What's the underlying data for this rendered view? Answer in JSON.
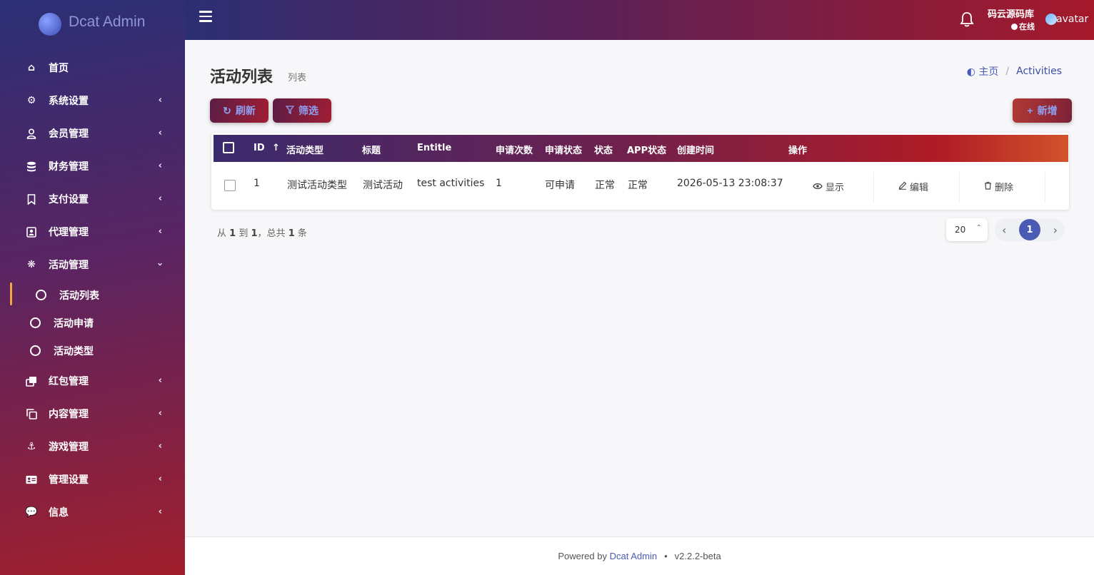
{
  "brand": {
    "name": "Dcat Admin"
  },
  "topbar": {
    "user_name": "码云源码库",
    "user_status": "在线",
    "avatar_alt": "avatar"
  },
  "sidebar": {
    "items": [
      {
        "label": "首页",
        "icon": "home-icon",
        "has_children": false
      },
      {
        "label": "系统设置",
        "icon": "gears-icon",
        "has_children": true
      },
      {
        "label": "会员管理",
        "icon": "user-icon",
        "has_children": true
      },
      {
        "label": "财务管理",
        "icon": "database-icon",
        "has_children": true
      },
      {
        "label": "支付设置",
        "icon": "bookmark-icon",
        "has_children": true
      },
      {
        "label": "代理管理",
        "icon": "contact-icon",
        "has_children": true
      },
      {
        "label": "活动管理",
        "icon": "fan-icon",
        "has_children": true,
        "expanded": true,
        "children": [
          {
            "label": "活动列表",
            "active": true
          },
          {
            "label": "活动申请",
            "active": false
          },
          {
            "label": "活动类型",
            "active": false
          }
        ]
      },
      {
        "label": "红包管理",
        "icon": "clone-icon",
        "has_children": true
      },
      {
        "label": "内容管理",
        "icon": "copy-icon",
        "has_children": true
      },
      {
        "label": "游戏管理",
        "icon": "anchor-icon",
        "has_children": true
      },
      {
        "label": "管理设置",
        "icon": "id-card-icon",
        "has_children": true
      },
      {
        "label": "信息",
        "icon": "comments-icon",
        "has_children": true
      }
    ]
  },
  "header": {
    "title": "活动列表",
    "subtitle": "列表",
    "breadcrumb": {
      "home": "主页",
      "current": "Activities"
    }
  },
  "toolbar": {
    "refresh_label": "刷新",
    "filter_label": "筛选",
    "new_label": "新增"
  },
  "table": {
    "columns": [
      "ID",
      "活动类型",
      "标题",
      "Entitle",
      "申请次数",
      "申请状态",
      "状态",
      "APP状态",
      "创建时间",
      "操作"
    ],
    "rows": [
      {
        "id": "1",
        "type": "测试活动类型",
        "title": "测试活动",
        "entitle": "test activities",
        "apply_count": "1",
        "apply_status": "可申请",
        "status": "正常",
        "app_status": "正常",
        "created_at": "2026-05-13 23:08:37",
        "actions": {
          "show": "显示",
          "edit": "编辑",
          "delete": "删除"
        }
      }
    ]
  },
  "pagination": {
    "summary": {
      "prefix": "从",
      "from": "1",
      "to_word": "到",
      "to": "1",
      "mid": "，总共",
      "total": "1",
      "suffix": "条"
    },
    "per_page": "20",
    "current_page": "1"
  },
  "footer": {
    "powered_by": "Powered by",
    "link": "Dcat Admin",
    "version": "v2.2.2-beta"
  },
  "colors": {
    "accent": "#4a5bb5",
    "active_marker": "#f0a93c"
  }
}
